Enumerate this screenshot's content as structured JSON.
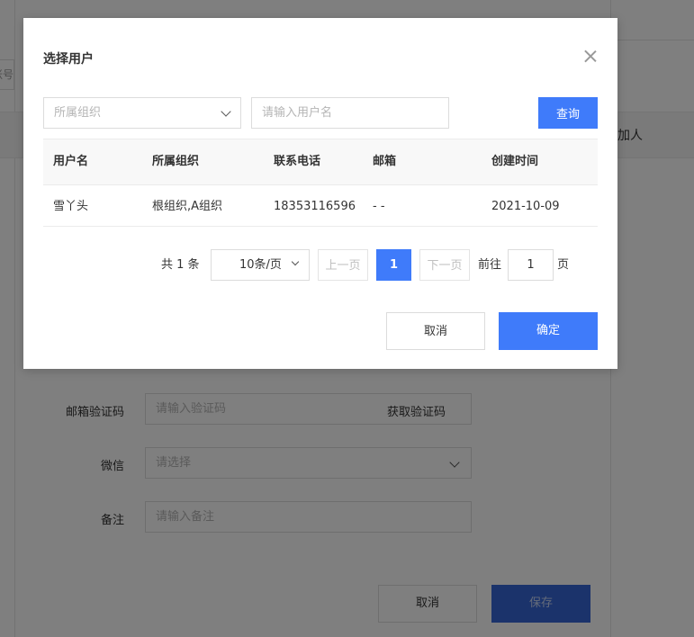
{
  "background": {
    "header_col_text": "加人",
    "partial_input_text": "账号",
    "rows": [
      {
        "label": "邮箱验证码",
        "placeholder": "请输入验证码",
        "button": "获取验证码"
      },
      {
        "label": "微信",
        "placeholder": "请选择"
      },
      {
        "label": "备注",
        "placeholder": "请输入备注"
      }
    ],
    "cancel_label": "取消",
    "save_label": "保存"
  },
  "dialog": {
    "title": "选择用户",
    "org_placeholder": "所属组织",
    "user_placeholder": "请输入用户名",
    "query_label": "查询",
    "table": {
      "headers": [
        "用户名",
        "所属组织",
        "联系电话",
        "邮箱",
        "创建时间"
      ],
      "rows": [
        [
          "雪丫头",
          "根组织,A组织",
          "18353116596",
          "- -",
          "2021-10-09"
        ]
      ]
    },
    "pagination": {
      "total_text": "共 1 条",
      "page_size": "10条/页",
      "prev_label": "上一页",
      "current_page": "1",
      "next_label": "下一页",
      "goto_label": "前往",
      "goto_value": "1",
      "page_unit": "页"
    },
    "cancel_label": "取消",
    "ok_label": "确定"
  },
  "colors": {
    "primary": "#3f7bfa",
    "overlay": "#000000"
  }
}
